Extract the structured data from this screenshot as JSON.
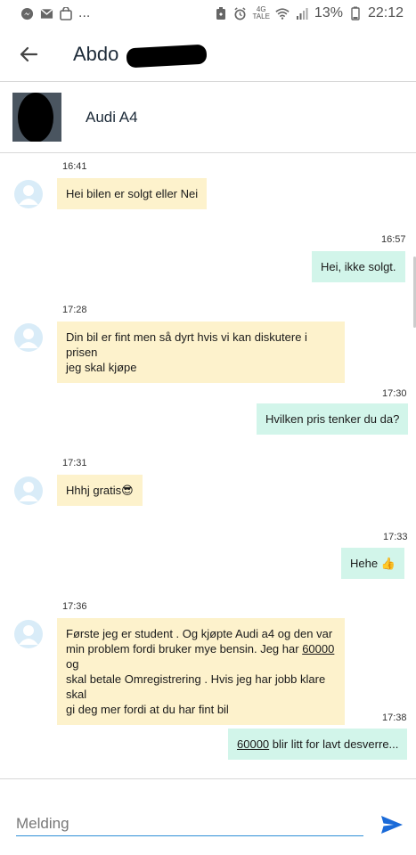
{
  "status_bar": {
    "battery": "13%",
    "clock": "22:12",
    "network_top": "4G",
    "network_bottom": "TALE",
    "icons_left": [
      "messenger-icon",
      "gmail-icon",
      "bag-icon",
      "more-dots-icon"
    ],
    "icons_right": [
      "alarm-icon",
      "wifi-icon",
      "signal-icon",
      "battery-icon"
    ],
    "dots": "..."
  },
  "header": {
    "contact_name": "Abdo"
  },
  "listing": {
    "title": "Audi A4"
  },
  "messages": [
    {
      "time": "16:41",
      "direction": "in",
      "text": "Hei bilen er solgt eller Nei"
    },
    {
      "time": "16:57",
      "direction": "out",
      "text": "Hei, ikke solgt."
    },
    {
      "time": "17:28",
      "direction": "in",
      "lines": [
        "Din bil er fint men så dyrt hvis vi kan diskutere i prisen",
        "jeg skal kjøpe"
      ]
    },
    {
      "time": "17:30",
      "direction": "out",
      "text": "Hvilken pris tenker du da?"
    },
    {
      "time": "17:31",
      "direction": "in",
      "text": "Hhhj gratis",
      "emoji": "😎"
    },
    {
      "time": "17:33",
      "direction": "out",
      "text": "Hehe",
      "emoji": "👍"
    },
    {
      "time": "17:36",
      "direction": "in",
      "lines": [
        "Første jeg er student . Og kjøpte Audi a4 og den var",
        "min problem fordi bruker mye bensin. Jeg har",
        "skal betale Omregistrering . Hvis jeg har jobb klare skal",
        "gi deg mer fordi at du har fint bil"
      ],
      "underlined_number": "60000",
      "line2_suffix": "og"
    },
    {
      "time": "17:38",
      "direction": "out",
      "underlined_number": "60000",
      "text": "blir litt for lavt desverre..."
    }
  ],
  "composer": {
    "placeholder": "Melding"
  },
  "colors": {
    "incoming_bubble": "#fdf2cc",
    "outgoing_bubble": "#d2f5ea",
    "accent": "#1a6ad8",
    "input_underline": "#2f8fd8"
  }
}
